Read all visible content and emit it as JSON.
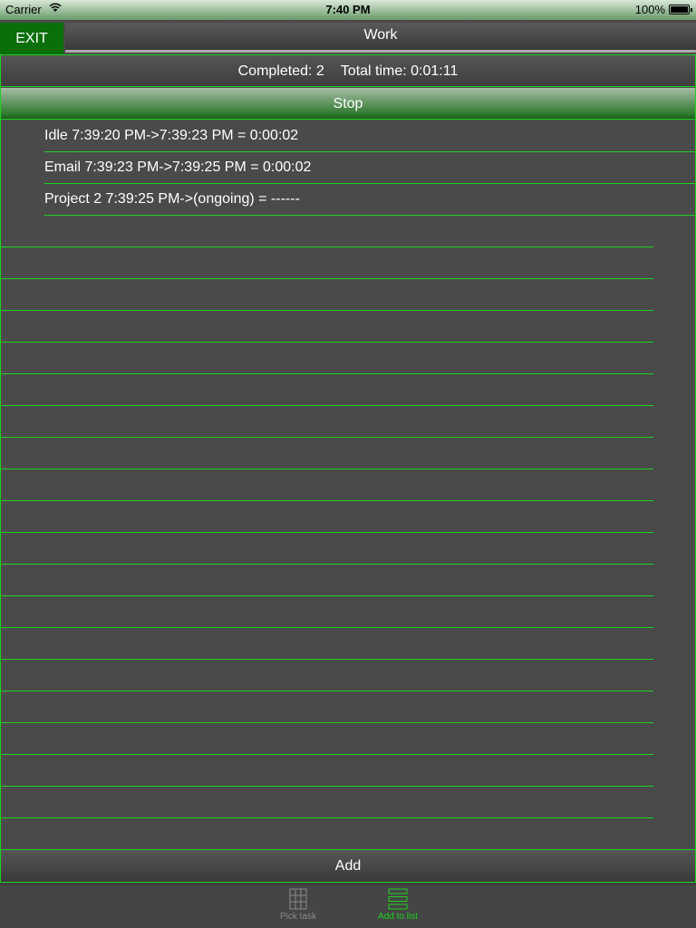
{
  "status_bar": {
    "carrier": "Carrier",
    "time": "7:40 PM",
    "battery": "100%"
  },
  "header": {
    "exit_label": "EXIT",
    "title": "Work"
  },
  "summary": {
    "completed": "Completed: 2",
    "total_time": "Total time: 0:01:11"
  },
  "stop_label": "Stop",
  "entries": [
    "Idle 7:39:20 PM->7:39:23 PM = 0:00:02",
    "Email 7:39:23 PM->7:39:25 PM = 0:00:02",
    "Project 2 7:39:25 PM->(ongoing) = ------"
  ],
  "add_label": "Add",
  "tabs": [
    {
      "label": "Pick task",
      "icon": "grid-icon",
      "selected": false
    },
    {
      "label": "Add to list",
      "icon": "list-icon",
      "selected": true
    }
  ],
  "colors": {
    "accent": "#1fd11f",
    "exit_bg": "#0a6f0a",
    "background": "#4a4a4a"
  }
}
